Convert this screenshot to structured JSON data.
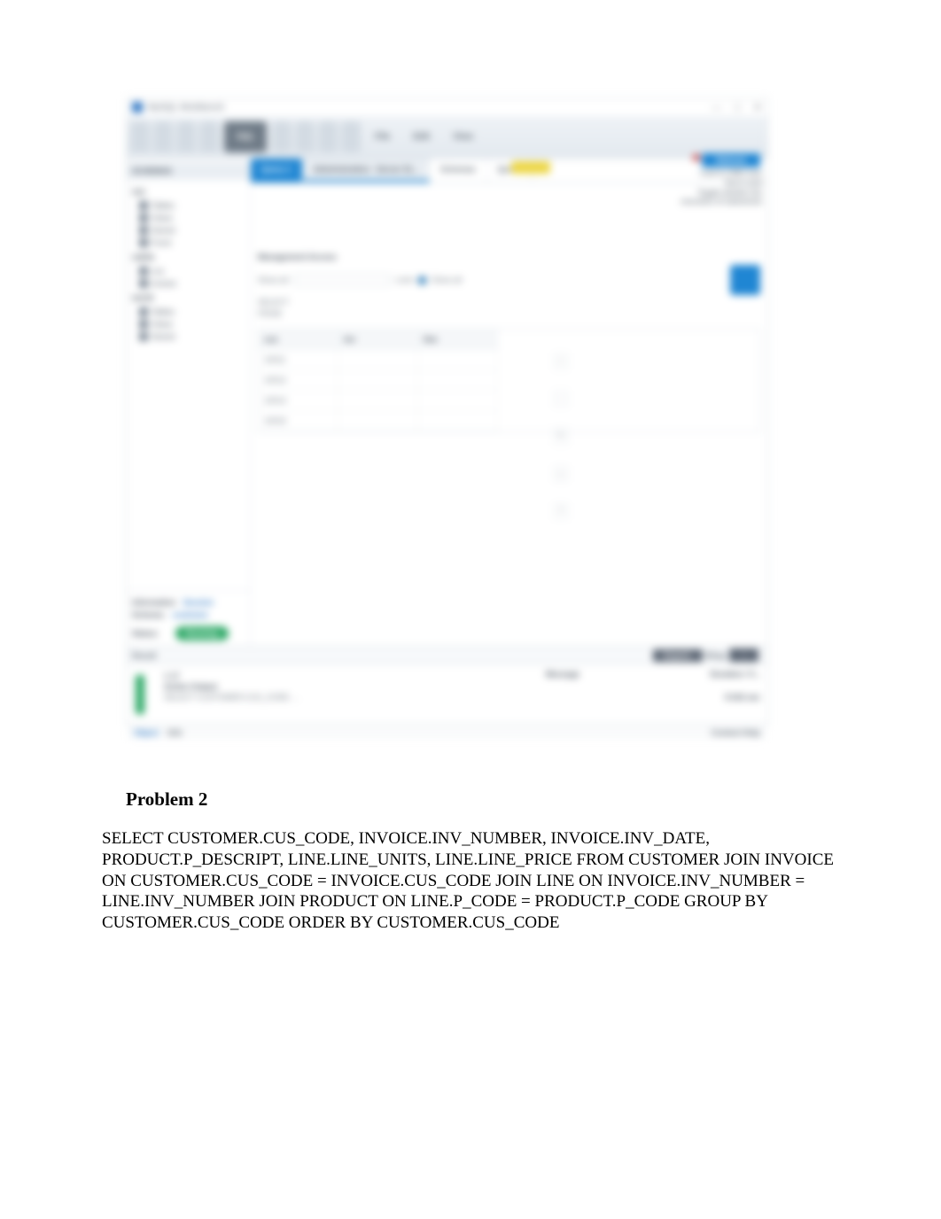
{
  "app": {
    "title": "MySQL Workbench",
    "window_controls": {
      "min": "—",
      "max": "□",
      "close": "✕"
    }
  },
  "toolbar": {
    "sql_label": "SQL",
    "menu": [
      "File",
      "Edit",
      "View"
    ]
  },
  "tabs": {
    "active": "Query 1",
    "sub_active": "Administration - Server St...",
    "others": [
      "Schemas",
      "Query"
    ],
    "yellow": "",
    "refresh_label": "Refresh"
  },
  "sidebar": {
    "header": "SCHEMAS",
    "group1_label": "sys",
    "group1_items": [
      "Tables",
      "Views",
      "Stored",
      "Funct"
    ],
    "group2_label": "sakila",
    "group2_items": [
      "cus",
      "invoice"
    ],
    "group3_label": "world",
    "group3_items": [
      "Tables",
      "Views",
      "Stored"
    ],
    "info_left": "Information",
    "info_right": "Session",
    "schema_left": "Schema:",
    "schema_right": "customer",
    "status_label": "Status:",
    "status_value": "Running"
  },
  "right_snippet": {
    "l1": "Limit to 1000 rows",
    "l2": "Don't Limit",
    "l3": "Toggle whether the",
    "l4": "execution of statements"
  },
  "query_panel": {
    "title": "Management Access",
    "row1": "Show all",
    "row2": "Limit",
    "code1": "SELECT",
    "code2": "FROM"
  },
  "grid": {
    "headers": [
      "cus",
      "inv",
      "line"
    ],
    "rows": [
      [
        "10011",
        "",
        ""
      ],
      [
        "10012",
        "",
        ""
      ],
      [
        "10014",
        "",
        ""
      ],
      [
        "10015",
        "",
        ""
      ]
    ],
    "side": [
      "+",
      "−",
      "✎",
      "□",
      "?"
    ]
  },
  "bottom_bar": {
    "left": "Result",
    "right1": "Export:",
    "right2": "Wrap"
  },
  "lower": {
    "line1": "1  17",
    "line2_lbl": "Action Output",
    "line2": "SELECT CUSTOMER.CUS_CODE …",
    "mid_lbl": "Message",
    "right1": "Duration / F...",
    "right2": "0.016 sec"
  },
  "statusbar": {
    "blue": "Object",
    "dark": "Info",
    "right": "Context Help"
  },
  "document": {
    "heading": "Problem 2",
    "body": "SELECT CUSTOMER.CUS_CODE, INVOICE.INV_NUMBER, INVOICE.INV_DATE, PRODUCT.P_DESCRIPT, LINE.LINE_UNITS, LINE.LINE_PRICE FROM CUSTOMER JOIN INVOICE ON CUSTOMER.CUS_CODE = INVOICE.CUS_CODE JOIN LINE ON INVOICE.INV_NUMBER = LINE.INV_NUMBER JOIN PRODUCT ON LINE.P_CODE = PRODUCT.P_CODE GROUP BY CUSTOMER.CUS_CODE ORDER BY CUSTOMER.CUS_CODE"
  }
}
